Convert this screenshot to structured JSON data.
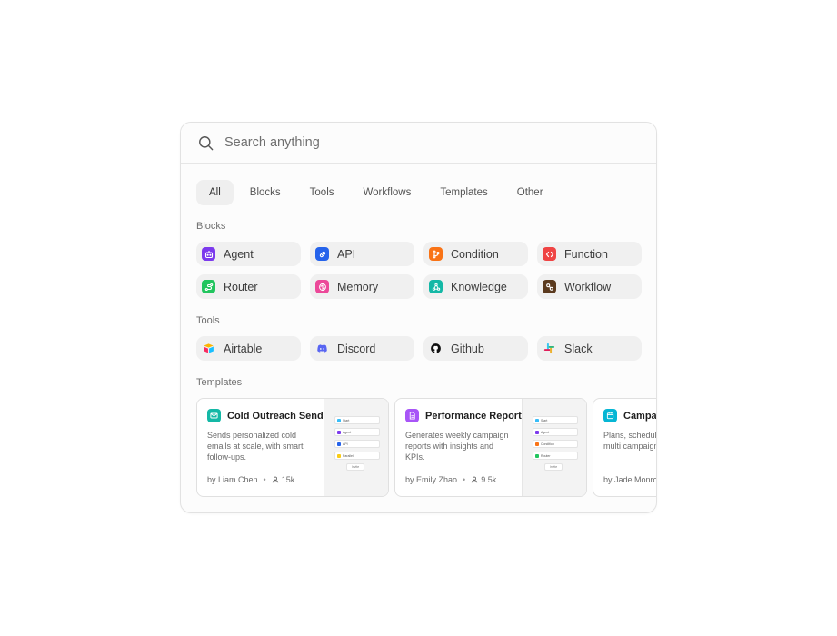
{
  "search": {
    "placeholder": "Search anything"
  },
  "tabs": [
    {
      "label": "All",
      "active": true
    },
    {
      "label": "Blocks"
    },
    {
      "label": "Tools"
    },
    {
      "label": "Workflows"
    },
    {
      "label": "Templates"
    },
    {
      "label": "Other"
    }
  ],
  "sections": {
    "blocks": "Blocks",
    "tools": "Tools",
    "templates": "Templates"
  },
  "blocks": [
    {
      "label": "Agent",
      "icon": "robot-icon",
      "color": "#7c3aed"
    },
    {
      "label": "API",
      "icon": "link-icon",
      "color": "#2563eb"
    },
    {
      "label": "Condition",
      "icon": "branch-icon",
      "color": "#f97316"
    },
    {
      "label": "Function",
      "icon": "code-icon",
      "color": "#ef4444"
    },
    {
      "label": "Router",
      "icon": "route-icon",
      "color": "#22c55e"
    },
    {
      "label": "Memory",
      "icon": "brain-icon",
      "color": "#ec4899"
    },
    {
      "label": "Knowledge",
      "icon": "network-icon",
      "color": "#14b8a6"
    },
    {
      "label": "Workflow",
      "icon": "workflow-icon",
      "color": "#5b3a1e"
    }
  ],
  "tools": [
    {
      "label": "Airtable",
      "icon": "airtable-icon"
    },
    {
      "label": "Discord",
      "icon": "discord-icon",
      "color": "#5865f2"
    },
    {
      "label": "Github",
      "icon": "github-icon",
      "color": "#111111"
    },
    {
      "label": "Slack",
      "icon": "slack-icon"
    }
  ],
  "templates": [
    {
      "title": "Cold Outreach Sender",
      "description": "Sends personalized cold emails at scale, with smart follow-ups.",
      "author": "by Liam Chen",
      "users": "15k",
      "icon": "mail-icon",
      "color": "#14b8a6",
      "preview": [
        "Start",
        "Agent",
        "API",
        "Parallel"
      ],
      "preview_button": "Invite"
    },
    {
      "title": "Performance Reporter",
      "description": "Generates weekly campaign reports with insights and KPIs.",
      "author": "by Emily Zhao",
      "users": "9.5k",
      "icon": "document-icon",
      "color": "#a855f7",
      "preview": [
        "Start",
        "Agent",
        "Condition",
        "Router"
      ],
      "preview_button": "Invite"
    },
    {
      "title": "Campaign Scheduler",
      "description": "Plans, schedules, launches multi campaigns auto",
      "author": "by Jade Monroe",
      "users": "",
      "icon": "calendar-icon",
      "color": "#06b6d4",
      "preview": [],
      "preview_button": ""
    }
  ]
}
